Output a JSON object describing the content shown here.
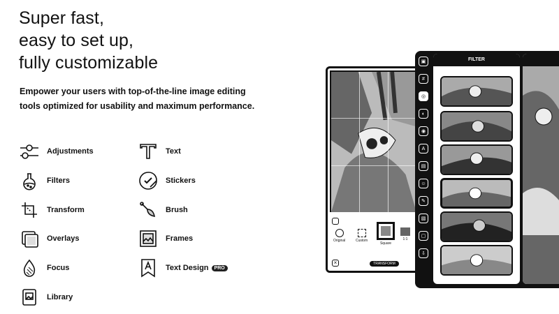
{
  "headline": {
    "line1": "Super fast,",
    "line2": "easy to set up,",
    "line3": "fully customizable"
  },
  "subtitle": {
    "line1": "Empower your users with top-of-the-line image editing",
    "line2": "tools optimized for usability and maximum performance."
  },
  "features": [
    {
      "label": "Adjustments",
      "icon": "sliders-icon"
    },
    {
      "label": "Text",
      "icon": "text-t-icon"
    },
    {
      "label": "Filters",
      "icon": "flask-icon"
    },
    {
      "label": "Stickers",
      "icon": "sticker-icon"
    },
    {
      "label": "Transform",
      "icon": "crop-icon"
    },
    {
      "label": "Brush",
      "icon": "brush-icon"
    },
    {
      "label": "Overlays",
      "icon": "overlay-icon"
    },
    {
      "label": "Frames",
      "icon": "frame-icon"
    },
    {
      "label": "Focus",
      "icon": "droplet-icon"
    },
    {
      "label": "Text Design",
      "icon": "text-design-icon",
      "badge": "PRO"
    },
    {
      "label": "Library",
      "icon": "library-icon"
    }
  ],
  "app": {
    "filter_header": "FILTER",
    "transform_button": "TRANSFORM",
    "bottom_options": [
      "Original",
      "Custom",
      "Square",
      "1:1"
    ]
  },
  "colors": {
    "ink": "#111111",
    "background": "#ffffff"
  }
}
